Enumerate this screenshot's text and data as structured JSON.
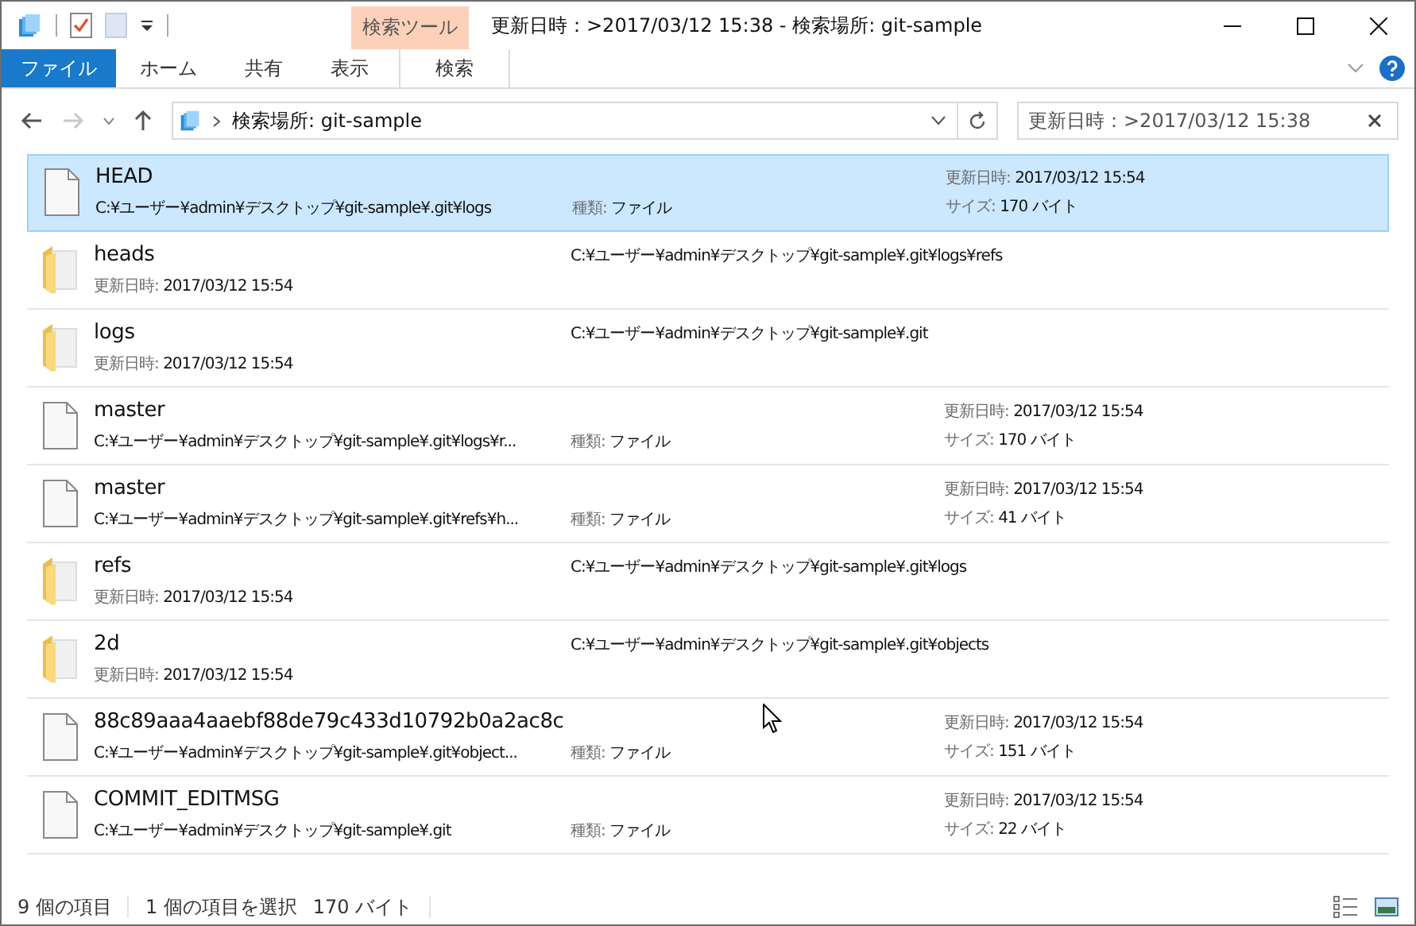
{
  "window": {
    "title": "更新日時：>2017/03/12 15:38 - 検索場所: git-sample",
    "context_tab_group": "検索ツール"
  },
  "ribbon_tabs": [
    {
      "label": "ファイル",
      "kind": "file"
    },
    {
      "label": "ホーム",
      "kind": "normal"
    },
    {
      "label": "共有",
      "kind": "normal"
    },
    {
      "label": "表示",
      "kind": "normal"
    },
    {
      "label": "検索",
      "kind": "context"
    }
  ],
  "address_bar": {
    "path": "検索場所: git-sample"
  },
  "search": {
    "value": "更新日時：>2017/03/12 15:38"
  },
  "items": [
    {
      "kind": "file",
      "name": "HEAD",
      "selected": true,
      "path": "C:¥ユーザー¥admin¥デスクトップ¥git-sample¥.git¥logs",
      "type_label": "種類:",
      "type": "ファイル",
      "date_label": "更新日時:",
      "date": "2017/03/12 15:54",
      "size_label": "サイズ:",
      "size": "170 バイト"
    },
    {
      "kind": "folder",
      "name": "heads",
      "selected": false,
      "path": "C:¥ユーザー¥admin¥デスクトップ¥git-sample¥.git¥logs¥refs",
      "date_label": "更新日時:",
      "date": "2017/03/12 15:54"
    },
    {
      "kind": "folder",
      "name": "logs",
      "selected": false,
      "path": "C:¥ユーザー¥admin¥デスクトップ¥git-sample¥.git",
      "date_label": "更新日時:",
      "date": "2017/03/12 15:54"
    },
    {
      "kind": "file",
      "name": "master",
      "selected": false,
      "path": "C:¥ユーザー¥admin¥デスクトップ¥git-sample¥.git¥logs¥r...",
      "type_label": "種類:",
      "type": "ファイル",
      "date_label": "更新日時:",
      "date": "2017/03/12 15:54",
      "size_label": "サイズ:",
      "size": "170 バイト"
    },
    {
      "kind": "file",
      "name": "master",
      "selected": false,
      "path": "C:¥ユーザー¥admin¥デスクトップ¥git-sample¥.git¥refs¥h...",
      "type_label": "種類:",
      "type": "ファイル",
      "date_label": "更新日時:",
      "date": "2017/03/12 15:54",
      "size_label": "サイズ:",
      "size": "41 バイト"
    },
    {
      "kind": "folder",
      "name": "refs",
      "selected": false,
      "path": "C:¥ユーザー¥admin¥デスクトップ¥git-sample¥.git¥logs",
      "date_label": "更新日時:",
      "date": "2017/03/12 15:54"
    },
    {
      "kind": "folder",
      "name": "2d",
      "selected": false,
      "path": "C:¥ユーザー¥admin¥デスクトップ¥git-sample¥.git¥objects",
      "date_label": "更新日時:",
      "date": "2017/03/12 15:54"
    },
    {
      "kind": "file",
      "name": "88c89aaa4aaebf88de79c433d10792b0a2ac8c",
      "selected": false,
      "path": "C:¥ユーザー¥admin¥デスクトップ¥git-sample¥.git¥object...",
      "type_label": "種類:",
      "type": "ファイル",
      "date_label": "更新日時:",
      "date": "2017/03/12 15:54",
      "size_label": "サイズ:",
      "size": "151 バイト"
    },
    {
      "kind": "file",
      "name": "COMMIT_EDITMSG",
      "selected": false,
      "path": "C:¥ユーザー¥admin¥デスクトップ¥git-sample¥.git",
      "type_label": "種類:",
      "type": "ファイル",
      "date_label": "更新日時:",
      "date": "2017/03/12 15:54",
      "size_label": "サイズ:",
      "size": "22 バイト"
    }
  ],
  "status_bar": {
    "count": "9 個の項目",
    "selection": "1 個の項目を選択",
    "size": "170 バイト"
  }
}
